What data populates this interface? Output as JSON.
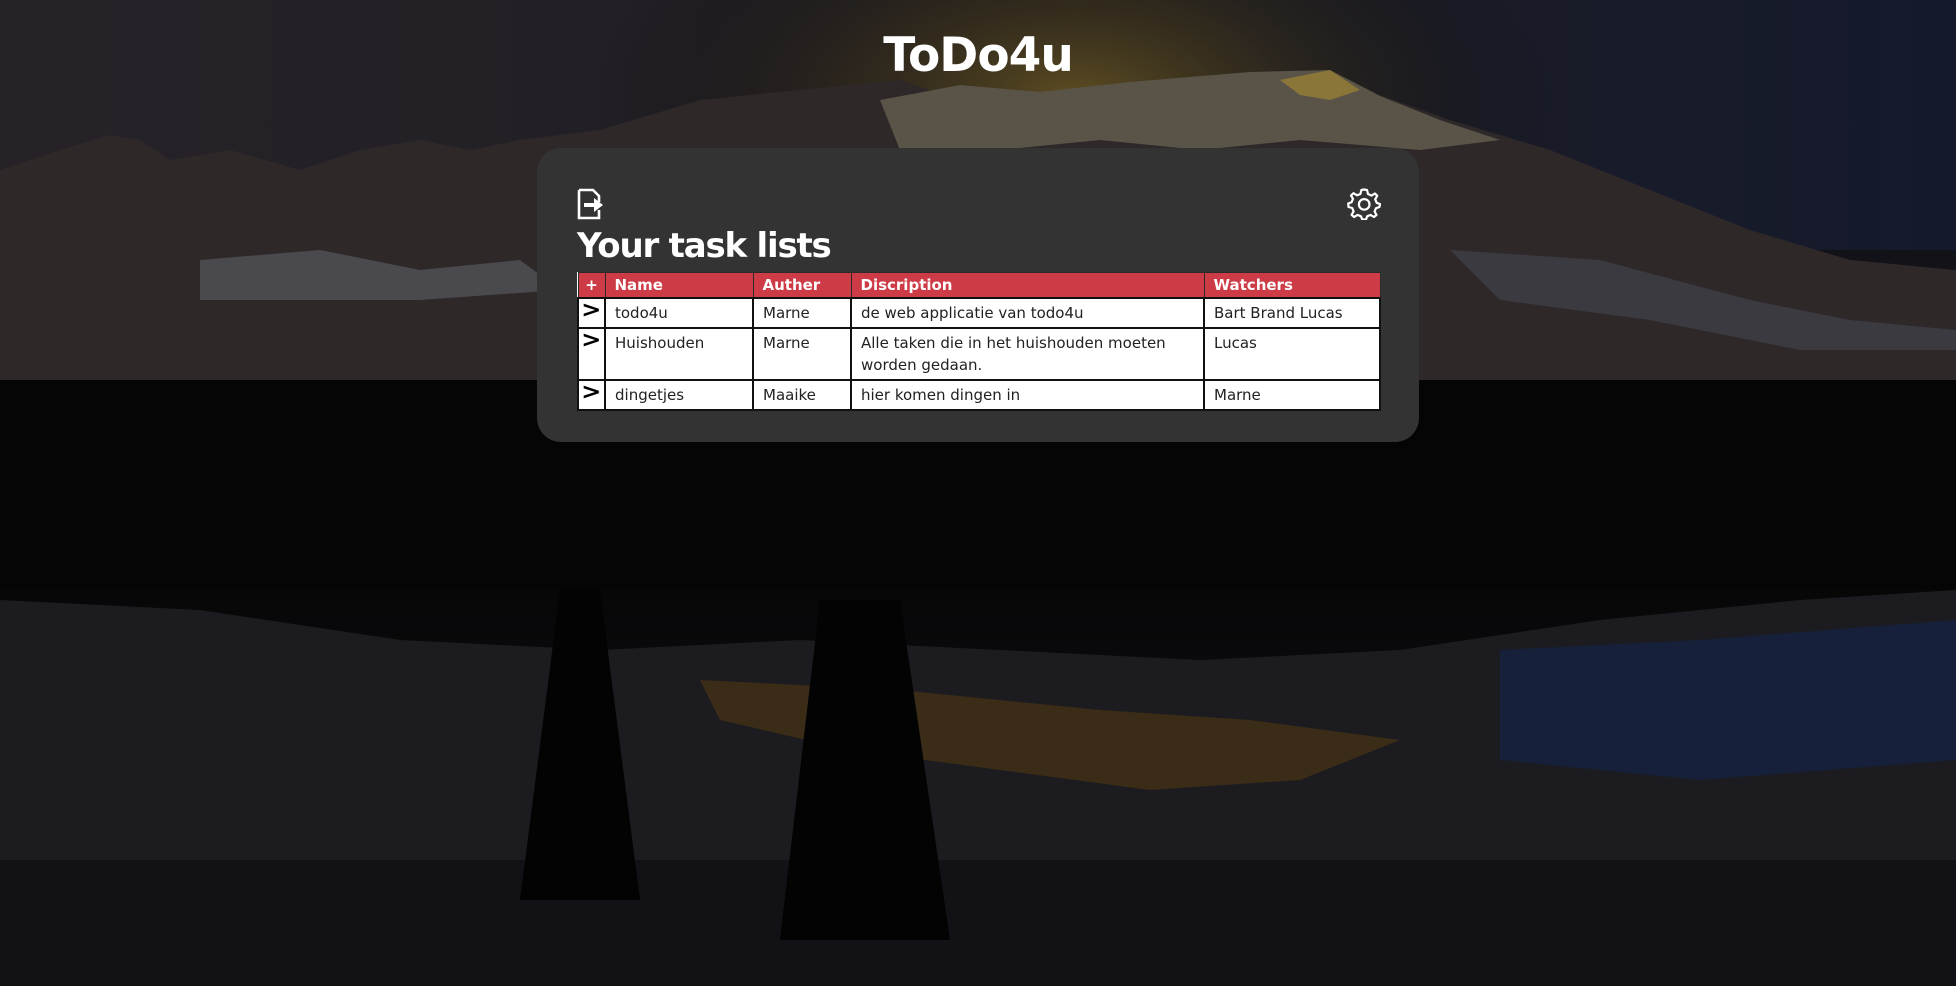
{
  "app": {
    "title": "ToDo4u"
  },
  "panel": {
    "title": "Your task lists",
    "logout_icon": "logout-icon",
    "settings_icon": "gear-icon"
  },
  "table": {
    "add_label": "+",
    "headers": {
      "name": "Name",
      "author": "Auther",
      "description": "Discription",
      "watchers": "Watchers"
    },
    "open_glyph": ">",
    "rows": [
      {
        "name": "todo4u",
        "author": "Marne",
        "description": "de web applicatie van todo4u",
        "watchers": "Bart Brand Lucas"
      },
      {
        "name": "Huishouden",
        "author": "Marne",
        "description": "Alle taken die in het huishouden moeten worden gedaan.",
        "watchers": "Lucas"
      },
      {
        "name": "dingetjes",
        "author": "Maaike",
        "description": "hier komen dingen in",
        "watchers": "Marne"
      }
    ]
  },
  "colors": {
    "panel_bg": "#333333",
    "header_bg": "#cd3c46",
    "title_text": "#ffffff"
  }
}
